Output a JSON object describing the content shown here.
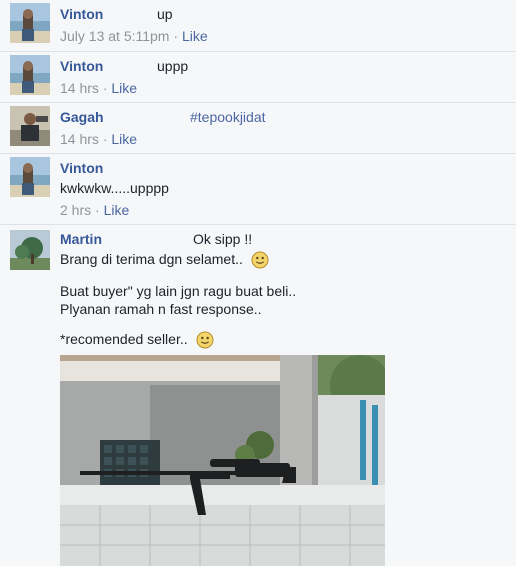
{
  "comments": [
    {
      "author": "Vinton",
      "text": "up",
      "timestamp": "July 13 at 5:11pm",
      "dot": "·",
      "like_label": "Like",
      "avatar": "beach-photo-avatar"
    },
    {
      "author": "Vinton",
      "text": "uppp",
      "timestamp": "14 hrs",
      "dot": "·",
      "like_label": "Like",
      "avatar": "beach-photo-avatar"
    },
    {
      "author": "Gagah",
      "text": "#tepookjidat",
      "timestamp": "14 hrs",
      "dot": "·",
      "like_label": "Like",
      "avatar": "person-photo-avatar"
    },
    {
      "author": "Vinton",
      "text": "kwkwkw.....upppp",
      "timestamp": "2 hrs",
      "dot": "·",
      "like_label": "Like",
      "avatar": "beach-photo-avatar"
    },
    {
      "author": "Martin",
      "first_line": "Ok sipp !!",
      "line2": "Brang di terima dgn selamet..",
      "line3": "Buat buyer\" yg lain jgn ragu buat beli..",
      "line4": "Plyanan ramah n fast response..",
      "line5": "*recomended seller..",
      "avatar": "tree-photo-avatar",
      "attachment": "photo-of-rifle-on-wall",
      "emoticon": "smiley-icon"
    }
  ],
  "colors": {
    "author": "#365899",
    "meta": "#90949c",
    "like": "#4b67a1",
    "background": "#f6f7f9",
    "text": "#1d2129"
  }
}
